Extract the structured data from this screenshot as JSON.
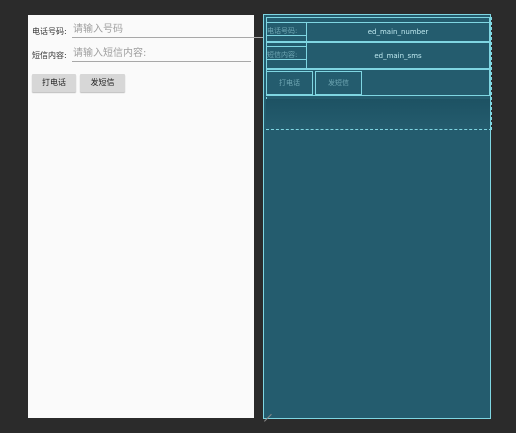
{
  "design": {
    "phone_label": "电话号码:",
    "phone_placeholder": "请输入号码",
    "sms_label": "短信内容:",
    "sms_placeholder": "请输入短信内容:",
    "call_button": "打电话",
    "sms_button": "发短信"
  },
  "blueprint": {
    "phone_label": "电话号码:",
    "phone_id": "ed_main_number",
    "sms_label": "短信内容:",
    "sms_id": "ed_main_sms",
    "call_button": "打电话",
    "sms_button": "发短信"
  },
  "colors": {
    "canvas_bg": "#2b2b2b",
    "design_bg": "#fafafa",
    "blueprint_bg": "#245c6e",
    "blueprint_line": "#7fd6e2"
  }
}
